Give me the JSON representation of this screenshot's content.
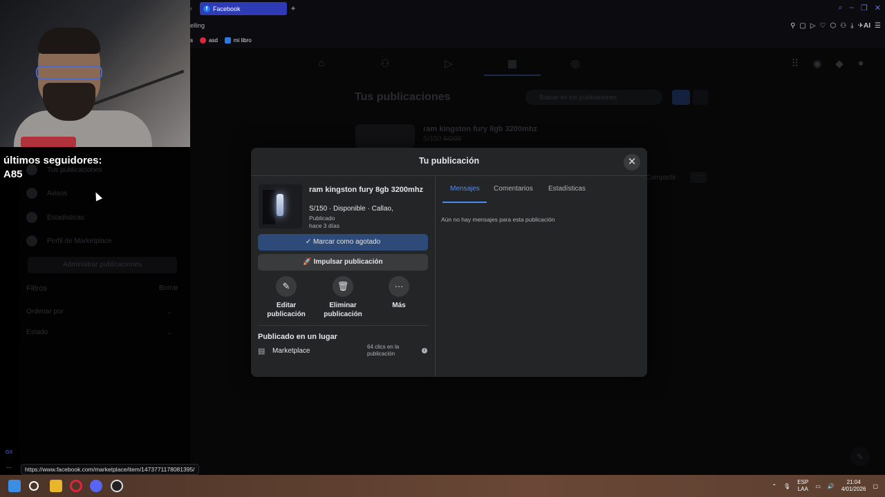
{
  "browser": {
    "tab_title": "Facebook",
    "tab_icon": "facebook-icon",
    "new_tab_glyph": "+",
    "address_fragment": "elling",
    "bookmarks": [
      {
        "label": "s",
        "icon": "none"
      },
      {
        "label": "asd",
        "icon": "opera-icon"
      },
      {
        "label": "mi libro",
        "icon": "doc-icon"
      }
    ],
    "toolbar_ai_label": "AI"
  },
  "webcam_overlay": {
    "followers_label": "últimos seguidores:",
    "followers_name": "A85"
  },
  "fb_page": {
    "title": "Tus publicaciones",
    "search_placeholder": "Buscar en tus publicaciones",
    "bg_item_title": "ram kingston fury 8gb 3200mhz",
    "bg_item_price": "S/150",
    "bg_item_old_price": "S/200",
    "share_label": "Compartir",
    "more_glyph": "···"
  },
  "sidebar": {
    "items": [
      {
        "label": "Tus publicaciones"
      },
      {
        "label": "Avisos"
      },
      {
        "label": "Estadísticas"
      },
      {
        "label": "Perfil de Marketplace"
      }
    ],
    "manage_button": "Administrar publicaciones",
    "filters_label": "Filtros",
    "filters_action": "Borrar",
    "sort_label": "Ordenar por",
    "state_label": "Estado"
  },
  "modal": {
    "title": "Tu publicación",
    "close_glyph": "✕",
    "item": {
      "title": "ram kingston fury 8gb 3200mhz",
      "meta": "S/150 · Disponible · Callao,",
      "status": "Publicado",
      "time": "hace 3 días"
    },
    "mark_sold_label": "Marcar como agotado",
    "boost_label": "Impulsar publicación",
    "actions": [
      {
        "label_line1": "Editar",
        "label_line2": "publicación",
        "glyph": "✎"
      },
      {
        "label_line1": "Eliminar",
        "label_line2": "publicación",
        "glyph": "🗑"
      },
      {
        "label_line1": "Más",
        "label_line2": "",
        "glyph": "···"
      }
    ],
    "placed_title": "Publicado en un lugar",
    "marketplace_label": "Marketplace",
    "clicks_text": "64 clics en la publicación",
    "tabs": [
      "Mensajes",
      "Comentarios",
      "Estadísticas"
    ],
    "active_tab": "Mensajes",
    "empty_messages": "Aún no hay mensajes para esta publicación",
    "accent_color": "#4d8cf7"
  },
  "status_bar": {
    "link_url": "https://www.facebook.com/marketplace/item/1473771178081395/",
    "gx_label": "GX",
    "dots": "···"
  },
  "taskbar": {
    "lang_line1": "ESP",
    "lang_line2": "LAA",
    "time": "21:04",
    "date": "4/01/2026"
  }
}
